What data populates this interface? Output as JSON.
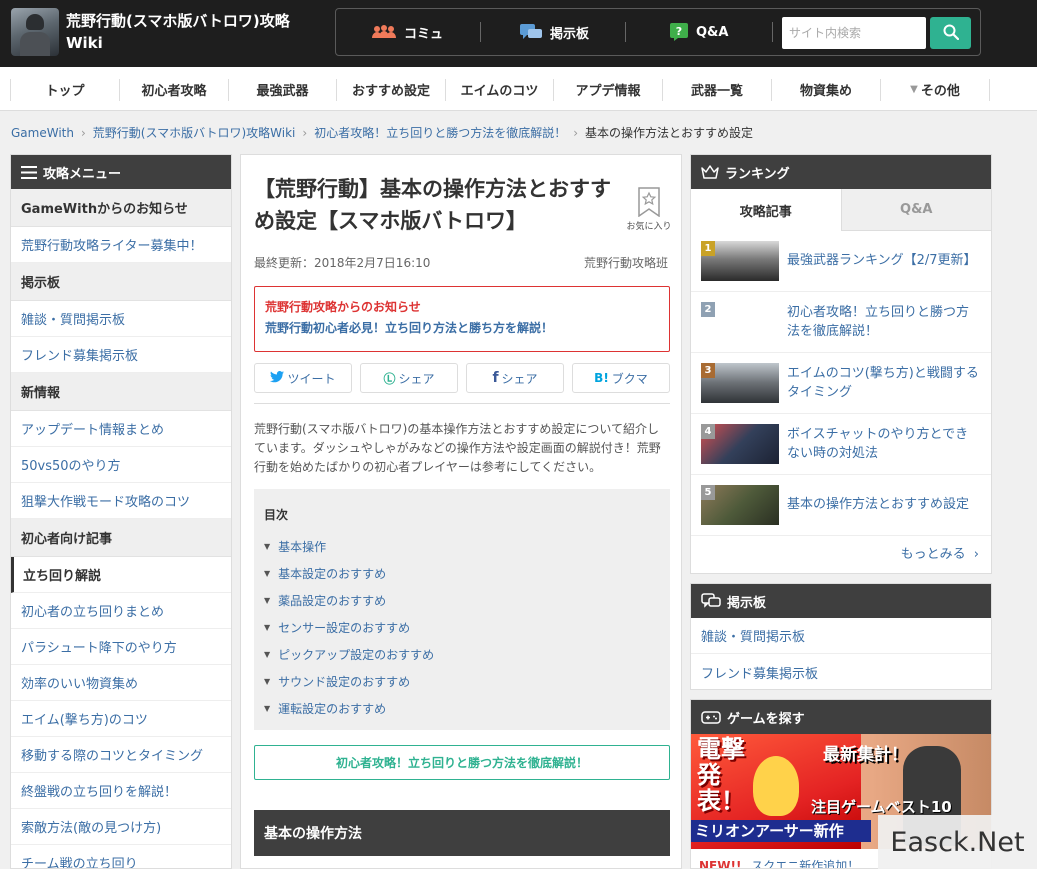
{
  "header": {
    "site_title": "荒野行動(スマホ版バトロワ)攻略Wiki",
    "nav": [
      {
        "label": "コミュ",
        "icon": "community-icon"
      },
      {
        "label": "掲示板",
        "icon": "bbs-icon"
      },
      {
        "label": "Q&A",
        "icon": "question-icon"
      }
    ],
    "search_placeholder": "サイト内検索",
    "search_icon": "search-icon"
  },
  "menu": [
    "トップ",
    "初心者攻略",
    "最強武器",
    "おすすめ設定",
    "エイムのコツ",
    "アプデ情報",
    "武器一覧",
    "物資集め",
    "その他"
  ],
  "breadcrumb": [
    "GameWith",
    "荒野行動(スマホ版バトロワ)攻略Wiki",
    "初心者攻略！立ち回りと勝つ方法を徹底解説！",
    "基本の操作方法とおすすめ設定"
  ],
  "left_menu": {
    "title": "攻略メニュー",
    "sections": [
      {
        "title": "GameWithからのお知らせ",
        "items": [
          "荒野行動攻略ライター募集中！"
        ]
      },
      {
        "title": "掲示板",
        "items": [
          "雑談・質問掲示板",
          "フレンド募集掲示板"
        ]
      },
      {
        "title": "新情報",
        "items": [
          "アップデート情報まとめ",
          "50vs50のやり方",
          "狙撃大作戦モード攻略のコツ"
        ]
      },
      {
        "title": "初心者向け記事",
        "items": [
          "立ち回り解説",
          "初心者の立ち回りまとめ",
          "パラシュート降下のやり方",
          "効率のいい物資集め",
          "エイム(撃ち方)のコツ",
          "移動する際のコツとタイミング",
          "終盤戦の立ち回りを解説！",
          "索敵方法(敵の見つけ方)",
          "チーム戦の立ち回り"
        ]
      }
    ]
  },
  "article": {
    "title": "【荒野行動】基本の操作方法とおすすめ設定【スマホ版バトロワ】",
    "favorite_label": "お気に入り",
    "updated": "最終更新：2018年2月7日16:10",
    "author": "荒野行動攻略班",
    "notice_title": "荒野行動攻略からのお知らせ",
    "notice_link": "荒野行動初心者必見！立ち回り方法と勝ち方を解説！",
    "share": [
      {
        "icon": "twitter-icon",
        "glyph": "🐦",
        "label": "ツイート"
      },
      {
        "icon": "line-icon",
        "glyph": "Ⓛ",
        "label": "シェア"
      },
      {
        "icon": "facebook-icon",
        "glyph": "f",
        "label": "シェア"
      },
      {
        "icon": "hatena-icon",
        "glyph": "B!",
        "label": "ブクマ"
      }
    ],
    "intro": "荒野行動(スマホ版バトロワ)の基本操作方法とおすすめ設定について紹介しています。ダッシュやしゃがみなどの操作方法や設定画面の解説付き！荒野行動を始めたばかりの初心者プレイヤーは参考にしてください。",
    "toc_title": "目次",
    "toc": [
      "基本操作",
      "基本設定のおすすめ",
      "薬品設定のおすすめ",
      "センサー設定のおすすめ",
      "ピックアップ設定のおすすめ",
      "サウンド設定のおすすめ",
      "運転設定のおすすめ"
    ],
    "cta": "初心者攻略！立ち回りと勝つ方法を徹底解説！",
    "section_heading": "基本の操作方法"
  },
  "ranking": {
    "title": "ランキング",
    "tabs": [
      "攻略記事",
      "Q&A"
    ],
    "items": [
      {
        "rank": "1",
        "text": "最強武器ランキング【2/7更新】",
        "badge_color": "#c9a227"
      },
      {
        "rank": "2",
        "text": "初心者攻略！立ち回りと勝つ方法を徹底解説！",
        "badge_color": "#8fa1b3"
      },
      {
        "rank": "3",
        "text": "エイムのコツ(撃ち方)と戦闘するタイミング",
        "badge_color": "#a86b32"
      },
      {
        "rank": "4",
        "text": "ボイスチャットのやり方とできない時の対処法",
        "badge_color": "#999999"
      },
      {
        "rank": "5",
        "text": "基本の操作方法とおすすめ設定",
        "badge_color": "#999999"
      }
    ],
    "more": "もっとみる"
  },
  "bbs": {
    "title": "掲示板",
    "items": [
      "雑談・質問掲示板",
      "フレンド募集掲示板"
    ]
  },
  "game_search": {
    "title": "ゲームを探す",
    "banner": {
      "text1": "電撃発表！",
      "text2": "最新集計！",
      "text3": "注目ゲームベスト10",
      "text4": "ミリオンアーサー新作"
    },
    "new_label": "NEW!!",
    "link": "スクエニ新作追加！"
  },
  "watermark": "Easck.Net",
  "colors": {
    "accent": "#2fb291",
    "header_bg": "#1e1e1e",
    "notice_red": "#dd3333",
    "link": "#3b6ea5"
  }
}
